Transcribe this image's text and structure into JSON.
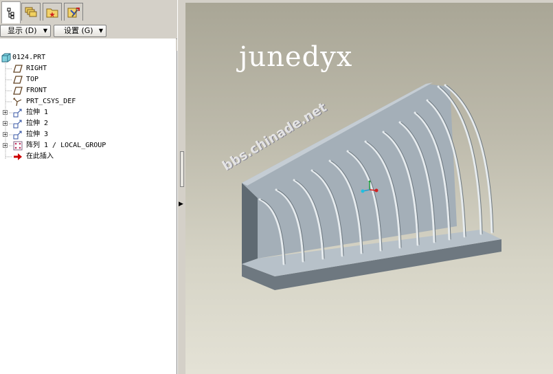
{
  "toolbar_tabs": [
    {
      "name": "model-tree-tab-icon",
      "active": true
    },
    {
      "name": "layers-tab-icon",
      "active": false
    },
    {
      "name": "folder-favorites-tab-icon",
      "active": false
    },
    {
      "name": "tools-tab-icon",
      "active": false
    }
  ],
  "buttons": {
    "show_label": "显示 (D)",
    "settings_label": "设置 (G)"
  },
  "tree": {
    "root": "0124.PRT",
    "items": [
      {
        "label": "RIGHT",
        "icon": "datum-plane-icon",
        "expandable": false
      },
      {
        "label": "TOP",
        "icon": "datum-plane-icon",
        "expandable": false
      },
      {
        "label": "FRONT",
        "icon": "datum-plane-icon",
        "expandable": false
      },
      {
        "label": "PRT_CSYS_DEF",
        "icon": "csys-icon",
        "expandable": false
      },
      {
        "label": "拉伸 1",
        "icon": "extrude-icon",
        "expandable": true
      },
      {
        "label": "拉伸 2",
        "icon": "extrude-icon",
        "expandable": true
      },
      {
        "label": "拉伸 3",
        "icon": "extrude-icon",
        "expandable": true
      },
      {
        "label": "阵列 1 / LOCAL_GROUP",
        "icon": "pattern-icon",
        "expandable": true
      },
      {
        "label": "在此插入",
        "icon": "insert-here-arrow-icon",
        "expandable": false
      }
    ]
  },
  "viewport": {
    "signature": "junedyx",
    "watermark": "bbs.chinade.net"
  },
  "colors": {
    "model_face": "#a7b2bb",
    "model_shadow": "#6d7780",
    "arrow_red": "#cc0000"
  }
}
